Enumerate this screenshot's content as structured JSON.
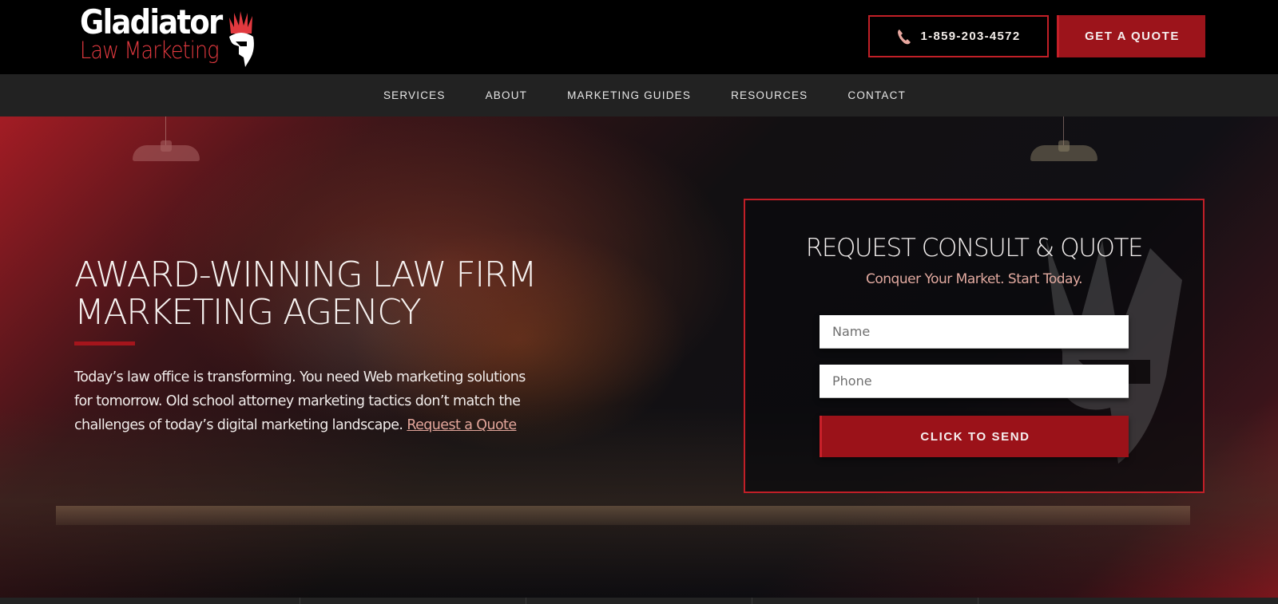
{
  "header": {
    "logo": {
      "line1": "Gladiator",
      "line2": "Law Marketing",
      "helmet_icon": "gladiator-helmet-icon"
    },
    "phone_button": {
      "icon": "phone-icon",
      "label": "1-859-203-4572"
    },
    "quote_button": {
      "label": "GET A QUOTE"
    }
  },
  "nav": {
    "items": [
      {
        "label": "SERVICES"
      },
      {
        "label": "ABOUT"
      },
      {
        "label": "MARKETING GUIDES"
      },
      {
        "label": "RESOURCES"
      },
      {
        "label": "CONTACT"
      }
    ]
  },
  "hero": {
    "title_line1": "AWARD-WINNING LAW FIRM",
    "title_line2": "MARKETING AGENCY",
    "body": "Today’s law office is transforming. You need Web marketing solutions for tomorrow. Old school attorney marketing tactics don’t match the challenges of today’s digital marketing landscape.",
    "link_label": "Request a Quote"
  },
  "form": {
    "title": "REQUEST CONSULT & QUOTE",
    "subtitle": "Conquer Your Market. Start Today.",
    "name_field": {
      "value": "",
      "placeholder": "Name"
    },
    "phone_field": {
      "value": "",
      "placeholder": "Phone"
    },
    "submit_label": "CLICK TO SEND"
  },
  "colors": {
    "brand_red": "#9c141b",
    "border_red": "#c11f27",
    "accent_pink": "#e1a99f",
    "nav_bg": "#222222",
    "header_bg": "#000000"
  }
}
